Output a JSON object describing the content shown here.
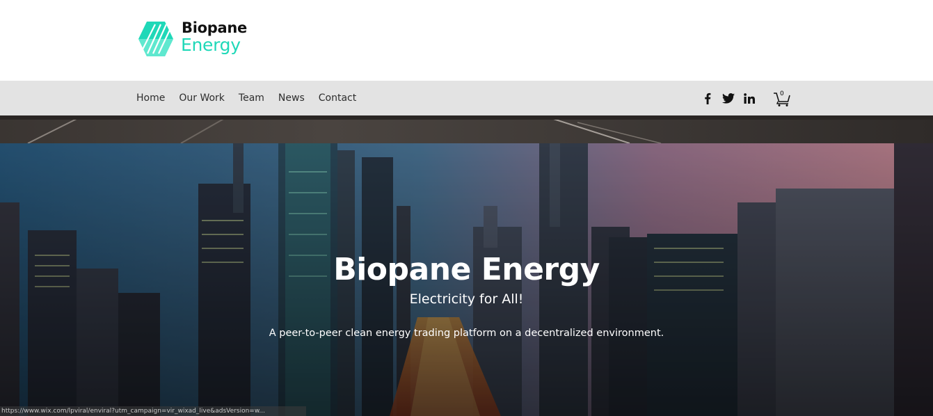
{
  "header": {
    "logo_word1": "Biopane",
    "logo_word2": "Energy",
    "brand_color": "#1fd8b8"
  },
  "nav": {
    "items": [
      {
        "label": "Home"
      },
      {
        "label": "Our Work"
      },
      {
        "label": "Team"
      },
      {
        "label": "News"
      },
      {
        "label": "Contact"
      }
    ],
    "social": [
      "facebook-icon",
      "twitter-icon",
      "linkedin-icon"
    ],
    "cart_count": "0"
  },
  "hero": {
    "title": "Biopane Energy",
    "subtitle": "Electricity for All!",
    "description": "A peer-to-peer clean energy trading platform on a decentralized environment."
  },
  "status_bar": {
    "url": "https://www.wix.com/lpviral/enviral?utm_campaign=vir_wixad_live&adsVersion=w..."
  }
}
